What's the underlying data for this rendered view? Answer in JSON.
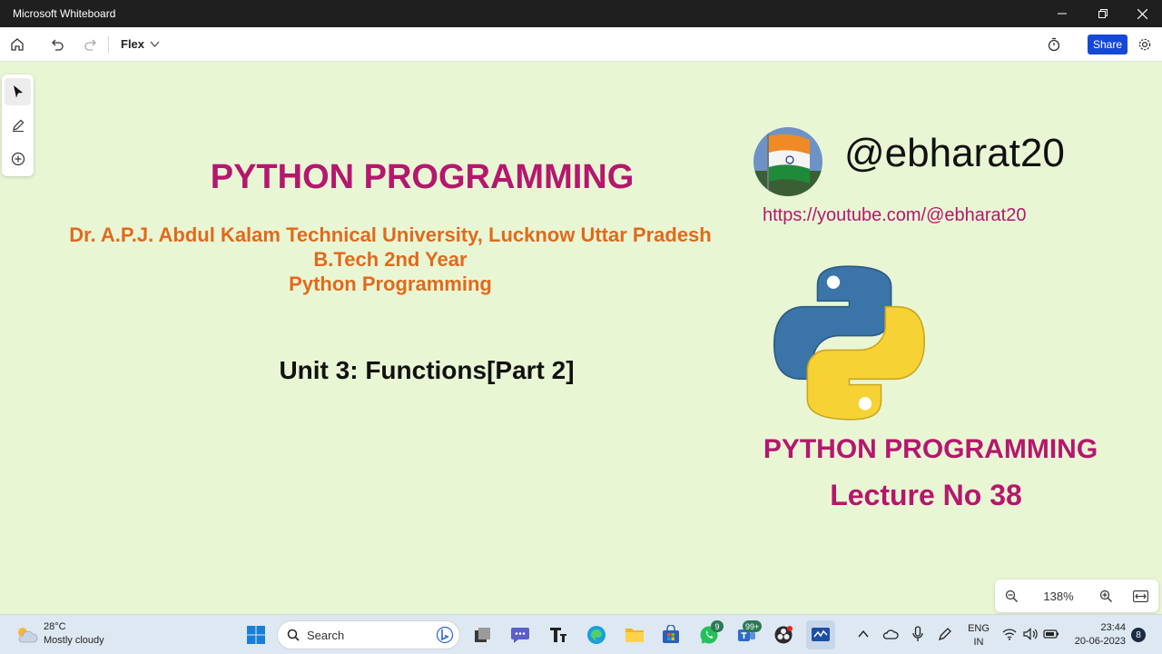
{
  "window": {
    "title": "Microsoft Whiteboard"
  },
  "toolbar": {
    "board_name": "Flex",
    "share_label": "Share"
  },
  "canvas": {
    "main_title": "PYTHON PROGRAMMING",
    "university": "Dr. A.P.J. Abdul Kalam Technical University, Lucknow Uttar Pradesh",
    "year": "B.Tech 2nd Year",
    "subject": "Python Programming",
    "unit": "Unit 3: Functions[Part 2]",
    "handle": "@ebharat20",
    "youtube_link": "https://youtube.com/@ebharat20",
    "right_title": "PYTHON PROGRAMMING",
    "lecture": "Lecture No 38"
  },
  "zoom": {
    "level": "138%"
  },
  "taskbar": {
    "temperature": "28°C",
    "weather": "Mostly cloudy",
    "search_placeholder": "Search",
    "whatsapp_badge": "9",
    "teams_badge": "99+",
    "language_line1": "ENG",
    "language_line2": "IN",
    "time": "23:44",
    "date": "20-06-2023",
    "notification_count": "8"
  },
  "colors": {
    "accent": "#b5176e",
    "orange": "#e06a1d",
    "canvas_bg": "#e9f6d4",
    "share_blue": "#1449d8"
  }
}
